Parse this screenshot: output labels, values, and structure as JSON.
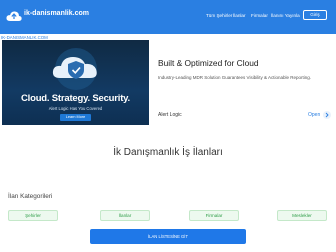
{
  "header": {
    "site_name": "ik-danismanlik.com",
    "nav": [
      "Tüm Şehirler",
      "İlanlar",
      "Firmalar",
      "İlanını Yayınla"
    ],
    "login": "Giriş"
  },
  "ad": {
    "tag": "IK-DANISMANLIK.COM",
    "image_headline": "Cloud. Strategy. Security.",
    "image_subline": "Alert Logic Has You Covered",
    "image_button": "Learn More",
    "title": "Built & Optimized for Cloud",
    "description": "Industry-Leading MDR Solution Guarantees Visibility & Actionable Reporting.",
    "advertiser": "Alert Logic",
    "open_label": "Open"
  },
  "main": {
    "title": "İk Danışmanlık İş İlanları",
    "categories_heading": "İlan Kategorileri",
    "categories": [
      "Şehirler",
      "İlanlar",
      "Firmalar",
      "Meslekler"
    ],
    "list_button": "İLAN LİSTESİNE GİT"
  },
  "colors": {
    "brand_blue": "#2a7fe2",
    "category_green": "#2e9d48"
  }
}
